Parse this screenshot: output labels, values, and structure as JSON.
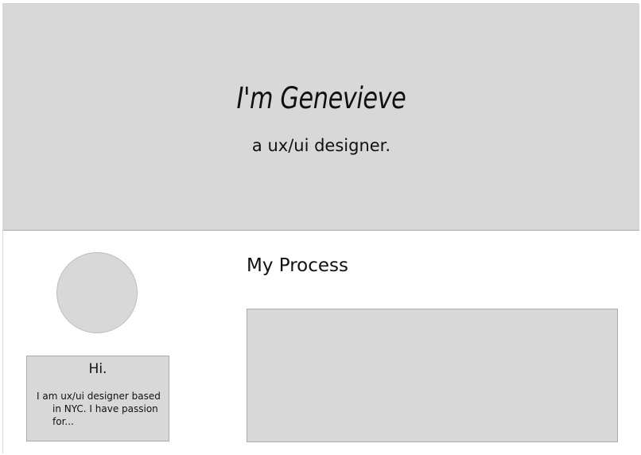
{
  "hero": {
    "title": "I'm Genevieve",
    "subtitle": "a ux/ui designer."
  },
  "intro": {
    "heading": "Hi.",
    "body": "I am ux/ui designer based in NYC. I have passion for..."
  },
  "process": {
    "title": "My Process"
  },
  "colors": {
    "placeholder_fill": "#d8d8d8",
    "placeholder_border": "#a9a9a9",
    "text": "#111111",
    "background": "#ffffff"
  }
}
